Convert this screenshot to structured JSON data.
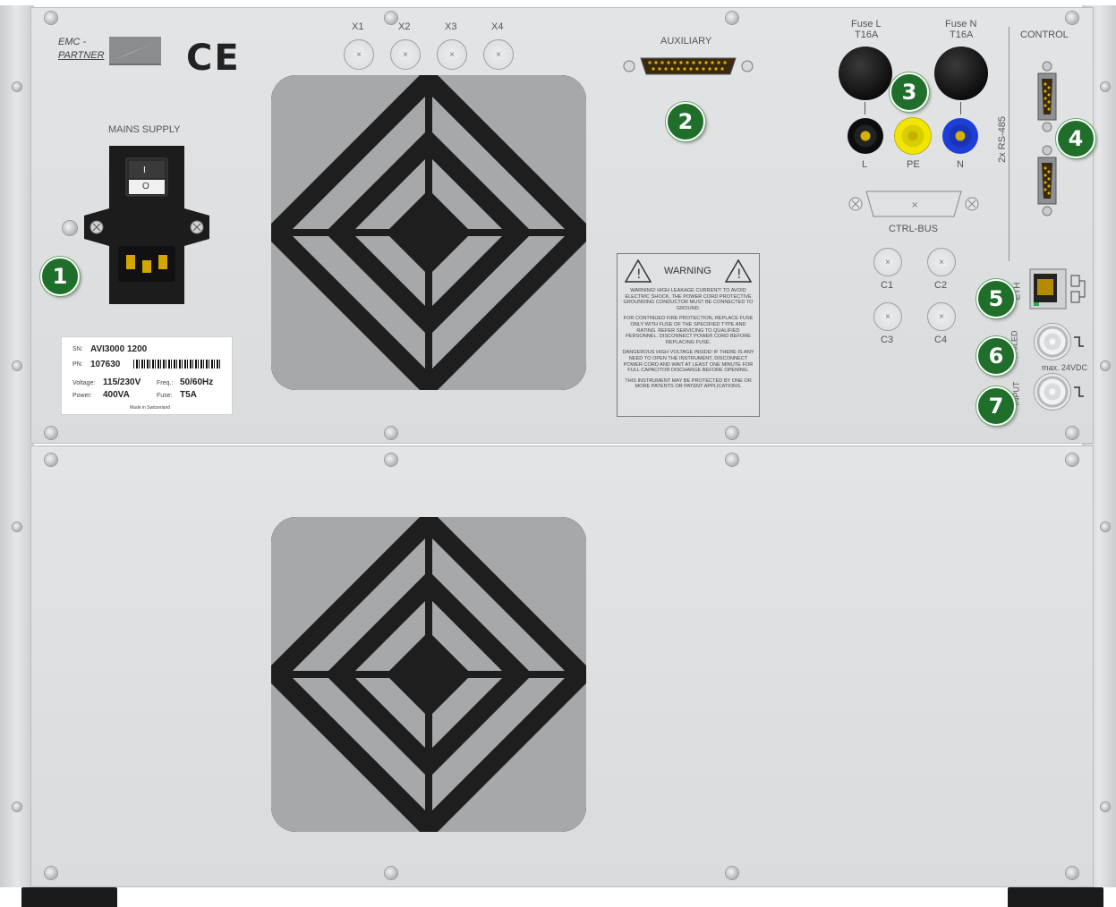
{
  "brand": {
    "line1": "EMC -",
    "line2": "PARTNER"
  },
  "ce_mark": "CE",
  "mains": {
    "label": "MAINS SUPPLY",
    "switch_on": "I",
    "switch_off": "O"
  },
  "auxiliary": {
    "label": "AUXILIARY"
  },
  "outputs": {
    "x1": "X1",
    "x2": "X2",
    "x3": "X3",
    "x4": "X4"
  },
  "fuses": {
    "l_name": "Fuse L",
    "l_rating": "T16A",
    "n_name": "Fuse N",
    "n_rating": "T16A"
  },
  "sockets": {
    "l": "L",
    "pe": "PE",
    "n": "N"
  },
  "control": {
    "label": "CONTROL",
    "rs485": "2x RS-485"
  },
  "ctrl_bus": {
    "label": "CTRL-BUS"
  },
  "coupling": {
    "c1": "C1",
    "c2": "C2",
    "c3": "C3",
    "c4": "C4"
  },
  "eth": {
    "label": "ETH"
  },
  "bnc": {
    "failed_label": "FAILED",
    "input_label": "INPUT",
    "max_voltage": "max. 24VDC"
  },
  "rating_label": {
    "sn_key": "SN:",
    "sn_value": "AVI3000 1200",
    "pn_key": "PN:",
    "pn_value": "107630",
    "voltage_key": "Voltage:",
    "voltage_value": "115/230V",
    "freq_key": "Freq.:",
    "freq_value": "50/60Hz",
    "power_key": "Power:",
    "power_value": "400VA",
    "fuse_key": "Fuse:",
    "fuse_value": "T5A",
    "made_in": "Made in Switzerland"
  },
  "warning": {
    "title": "WARNING",
    "p1": "WARNING! HIGH LEAKAGE CURRENT! TO AVOID ELECTRIC SHOCK, THE POWER CORD PROTECTIVE GROUNDING CONDUCTOR MUST BE CONNECTED TO GROUND.",
    "p2": "FOR CONTINUED FIRE PROTECTION, REPLACE FUSE ONLY WITH FUSE OF THE SPECIFIED TYPE AND RATING. REFER SERVICING TO QUALIFIED PERSONNEL. DISCONNECT POWER CORD BEFORE REPLACING FUSE.",
    "p3": "DANGEROUS HIGH VOLTAGE INSIDE! IF THERE IS ANY NEED TO OPEN THE INSTRUMENT, DISCONNECT POWER CORD AND WAIT AT LEAST ONE MINUTE FOR FULL CAPACITOR DISCHARGE BEFORE OPENING.",
    "p4": "THIS INSTRUMENT MAY BE PROTECTED BY ONE OR MORE PATENTS OR PATENT APPLICATIONS."
  },
  "callouts": [
    "1",
    "2",
    "3",
    "4",
    "5",
    "6",
    "7"
  ],
  "colors": {
    "callout": "#1f6e2a",
    "panel": "#dedfe1",
    "pe_socket": "#f2e500",
    "n_socket": "#1d3fd6",
    "l_socket": "#111111",
    "fan": "#1e1e1e",
    "fan_grille": "#a7a8a9"
  }
}
